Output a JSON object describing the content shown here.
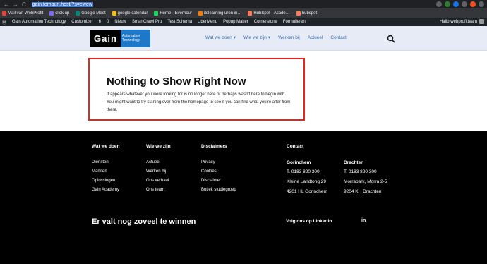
{
  "browser": {
    "url": "gain.tempurl.host/?s=ewew",
    "nav_back": "←",
    "nav_forward": "→",
    "nav_reload": "C"
  },
  "bookmarks": [
    "Mail van WebProfit",
    "click up",
    "Google Meet",
    "google calendar",
    "Home - Everhour",
    "itslearning uren in…",
    "HubSpot - Acade…",
    "hubspot"
  ],
  "wp_admin_bar": {
    "items": [
      "Gain Automation Technology",
      "Customizer",
      "6",
      "0",
      "Nieuw",
      "SmartCrawl Pro",
      "Test Schema",
      "UberMenu",
      "Popup Maker",
      "Cornerstone",
      "Formulieren"
    ],
    "greeting": "Hallo webprofitteam"
  },
  "header": {
    "logo_text": "Gain",
    "logo_subtext_1": "Automation",
    "logo_subtext_2": "Technology",
    "nav": [
      {
        "label": "Wat we doen",
        "dropdown": true
      },
      {
        "label": "Wie we zijn",
        "dropdown": true
      },
      {
        "label": "Werken bij",
        "dropdown": false
      },
      {
        "label": "Actueel",
        "dropdown": false
      },
      {
        "label": "Contact",
        "dropdown": false
      }
    ]
  },
  "content": {
    "title": "Nothing to Show Right Now",
    "text": "It appears whatever you were looking for is no longer here or perhaps wasn't here to begin with. You might want to try starting over from the homepage to see if you can find what you're after from there."
  },
  "footer": {
    "col1": {
      "heading": "Wat we doen",
      "items": [
        "Diensten",
        "Markten",
        "Oplossingen",
        "Gain Academy"
      ]
    },
    "col2": {
      "heading": "Wie we zijn",
      "items": [
        "Actueel",
        "Werken bij",
        "Ons verhaal",
        "Ons team"
      ]
    },
    "col3": {
      "heading": "Disclaimers",
      "items": [
        "Privacy",
        "Cookies",
        "Disclaimer",
        "Botlek studiegroep"
      ]
    },
    "contact": {
      "heading": "Contact",
      "gorinchem": {
        "city": "Gorinchem",
        "phone": "T. 0183 820 300",
        "street": "Kleine Landtong 29",
        "zip": "4201 HL Gorinchem"
      },
      "drachten": {
        "city": "Drachten",
        "phone": "T. 0183 820 300",
        "street": "Morrapark, Morra 2-5",
        "zip": "9204 KH Drachten"
      }
    },
    "tagline": "Er valt nog zoveel te winnen",
    "follow": "Volg ons op LinkedIn",
    "linkedin": "in"
  },
  "colors": {
    "accent": "#e8241b",
    "brand_blue": "#1e78c8",
    "nav_link": "#3b6fb6",
    "header_bg": "#e6ebf6"
  }
}
